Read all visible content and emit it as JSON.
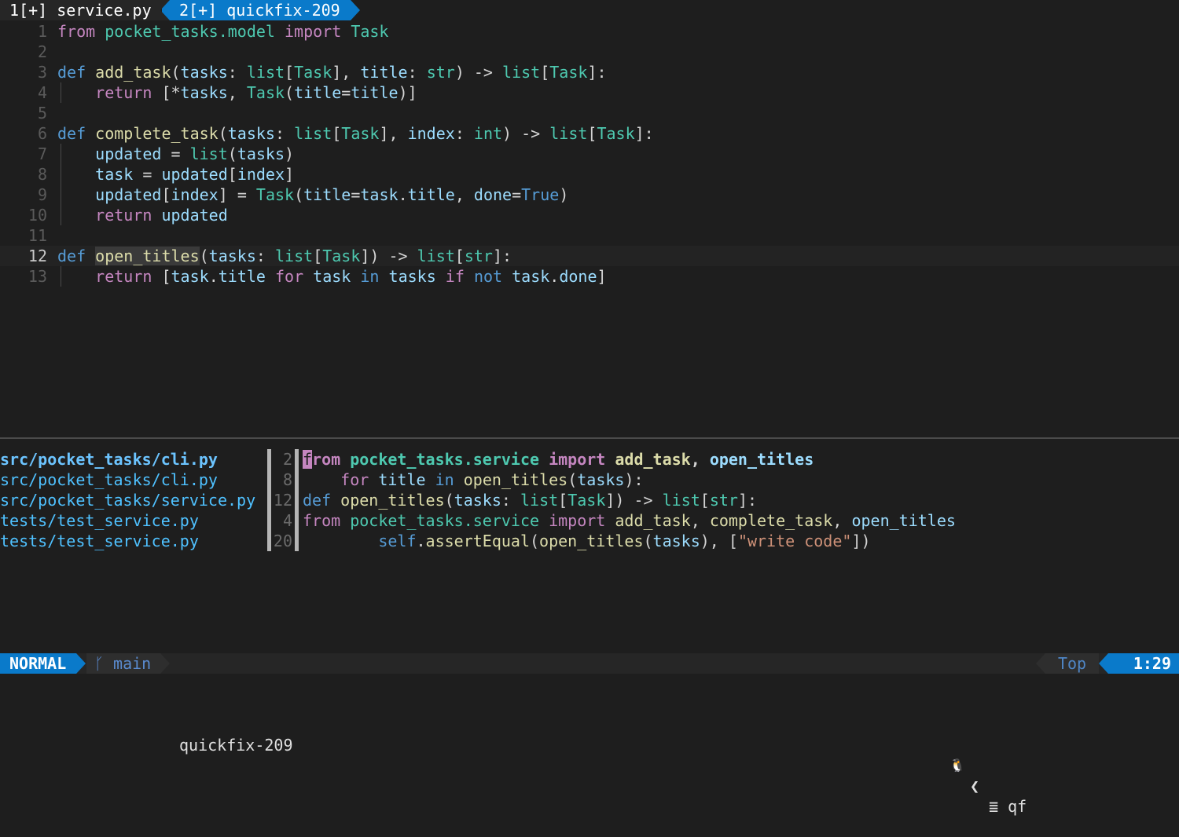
{
  "tabs": [
    {
      "label": "1[+] service.py"
    },
    {
      "label": "2[+] quickfix-209"
    }
  ],
  "editor": {
    "lines": [
      {
        "n": "1",
        "parts": [
          [
            "kw",
            "from"
          ],
          [
            "op",
            " "
          ],
          [
            "ty",
            "pocket_tasks.model"
          ],
          [
            "op",
            " "
          ],
          [
            "kw",
            "import"
          ],
          [
            "op",
            " "
          ],
          [
            "ty",
            "Task"
          ]
        ]
      },
      {
        "n": "2",
        "parts": []
      },
      {
        "n": "3",
        "parts": [
          [
            "kwb",
            "def"
          ],
          [
            "op",
            " "
          ],
          [
            "fn",
            "add_task"
          ],
          [
            "op",
            "("
          ],
          [
            "var",
            "tasks"
          ],
          [
            "op",
            ": "
          ],
          [
            "blt",
            "list"
          ],
          [
            "op",
            "["
          ],
          [
            "ty",
            "Task"
          ],
          [
            "op",
            "], "
          ],
          [
            "var",
            "title"
          ],
          [
            "op",
            ": "
          ],
          [
            "blt",
            "str"
          ],
          [
            "op",
            ") -> "
          ],
          [
            "blt",
            "list"
          ],
          [
            "op",
            "["
          ],
          [
            "ty",
            "Task"
          ],
          [
            "op",
            "]:"
          ]
        ]
      },
      {
        "n": "4",
        "parts": [
          [
            "op",
            "    "
          ],
          [
            "kw",
            "return"
          ],
          [
            "op",
            " [*"
          ],
          [
            "var",
            "tasks"
          ],
          [
            "op",
            ", "
          ],
          [
            "ty",
            "Task"
          ],
          [
            "op",
            "("
          ],
          [
            "var",
            "title"
          ],
          [
            "op",
            "="
          ],
          [
            "var",
            "title"
          ],
          [
            "op",
            ")]"
          ]
        ]
      },
      {
        "n": "5",
        "parts": []
      },
      {
        "n": "6",
        "parts": [
          [
            "kwb",
            "def"
          ],
          [
            "op",
            " "
          ],
          [
            "fn",
            "complete_task"
          ],
          [
            "op",
            "("
          ],
          [
            "var",
            "tasks"
          ],
          [
            "op",
            ": "
          ],
          [
            "blt",
            "list"
          ],
          [
            "op",
            "["
          ],
          [
            "ty",
            "Task"
          ],
          [
            "op",
            "], "
          ],
          [
            "var",
            "index"
          ],
          [
            "op",
            ": "
          ],
          [
            "blt",
            "int"
          ],
          [
            "op",
            ") -> "
          ],
          [
            "blt",
            "list"
          ],
          [
            "op",
            "["
          ],
          [
            "ty",
            "Task"
          ],
          [
            "op",
            "]:"
          ]
        ]
      },
      {
        "n": "7",
        "parts": [
          [
            "op",
            "    "
          ],
          [
            "var",
            "updated"
          ],
          [
            "op",
            " = "
          ],
          [
            "blt",
            "list"
          ],
          [
            "op",
            "("
          ],
          [
            "var",
            "tasks"
          ],
          [
            "op",
            ")"
          ]
        ]
      },
      {
        "n": "8",
        "parts": [
          [
            "op",
            "    "
          ],
          [
            "var",
            "task"
          ],
          [
            "op",
            " = "
          ],
          [
            "var",
            "updated"
          ],
          [
            "op",
            "["
          ],
          [
            "var",
            "index"
          ],
          [
            "op",
            "]"
          ]
        ]
      },
      {
        "n": "9",
        "parts": [
          [
            "op",
            "    "
          ],
          [
            "var",
            "updated"
          ],
          [
            "op",
            "["
          ],
          [
            "var",
            "index"
          ],
          [
            "op",
            "] = "
          ],
          [
            "ty",
            "Task"
          ],
          [
            "op",
            "("
          ],
          [
            "var",
            "title"
          ],
          [
            "op",
            "="
          ],
          [
            "var",
            "task"
          ],
          [
            "op",
            "."
          ],
          [
            "var",
            "title"
          ],
          [
            "op",
            ", "
          ],
          [
            "var",
            "done"
          ],
          [
            "op",
            "="
          ],
          [
            "cnst",
            "True"
          ],
          [
            "op",
            ")"
          ]
        ]
      },
      {
        "n": "10",
        "parts": [
          [
            "op",
            "    "
          ],
          [
            "kw",
            "return"
          ],
          [
            "op",
            " "
          ],
          [
            "var",
            "updated"
          ]
        ]
      },
      {
        "n": "11",
        "parts": []
      },
      {
        "n": "12",
        "parts": [
          [
            "kwb",
            "def"
          ],
          [
            "op",
            " "
          ],
          [
            "fn hl",
            "open_titles"
          ],
          [
            "op",
            "("
          ],
          [
            "var",
            "tasks"
          ],
          [
            "op",
            ": "
          ],
          [
            "blt",
            "list"
          ],
          [
            "op",
            "["
          ],
          [
            "ty",
            "Task"
          ],
          [
            "op",
            "]) -> "
          ],
          [
            "blt",
            "list"
          ],
          [
            "op",
            "["
          ],
          [
            "blt",
            "str"
          ],
          [
            "op",
            "]:"
          ]
        ]
      },
      {
        "n": "13",
        "parts": [
          [
            "op",
            "    "
          ],
          [
            "kw",
            "return"
          ],
          [
            "op",
            " ["
          ],
          [
            "var",
            "task"
          ],
          [
            "op",
            "."
          ],
          [
            "var",
            "title"
          ],
          [
            "op",
            " "
          ],
          [
            "kw",
            "for"
          ],
          [
            "op",
            " "
          ],
          [
            "var",
            "task"
          ],
          [
            "op",
            " "
          ],
          [
            "kwb",
            "in"
          ],
          [
            "op",
            " "
          ],
          [
            "var",
            "tasks"
          ],
          [
            "op",
            " "
          ],
          [
            "kw",
            "if"
          ],
          [
            "op",
            " "
          ],
          [
            "kwb",
            "not"
          ],
          [
            "op",
            " "
          ],
          [
            "var",
            "task"
          ],
          [
            "op",
            "."
          ],
          [
            "var",
            "done"
          ],
          [
            "op",
            "]"
          ]
        ]
      }
    ],
    "current_line": "12"
  },
  "quickfix": {
    "items": [
      {
        "file": "src/pocket_tasks/cli.py",
        "line": "2",
        "parts": [
          [
            "cursor kw",
            "f"
          ],
          [
            "kw bold",
            "rom"
          ],
          [
            "op",
            " "
          ],
          [
            "ty bold",
            "pocket_tasks.service"
          ],
          [
            "op",
            " "
          ],
          [
            "kw bold",
            "import"
          ],
          [
            "op",
            " "
          ],
          [
            "fn bold",
            "add_task"
          ],
          [
            "op bold",
            ", "
          ],
          [
            "var bold",
            "open_titles"
          ]
        ]
      },
      {
        "file": "src/pocket_tasks/cli.py",
        "line": "8",
        "parts": [
          [
            "op",
            "    "
          ],
          [
            "kw",
            "for"
          ],
          [
            "op",
            " "
          ],
          [
            "var",
            "title"
          ],
          [
            "op",
            " "
          ],
          [
            "kwb",
            "in"
          ],
          [
            "op",
            " "
          ],
          [
            "fn",
            "open_titles"
          ],
          [
            "op",
            "("
          ],
          [
            "var",
            "tasks"
          ],
          [
            "op",
            "):"
          ]
        ]
      },
      {
        "file": "src/pocket_tasks/service.py",
        "line": "12",
        "parts": [
          [
            "kwb",
            "def"
          ],
          [
            "op",
            " "
          ],
          [
            "fn",
            "open_titles"
          ],
          [
            "op",
            "("
          ],
          [
            "var",
            "tasks"
          ],
          [
            "op",
            ": "
          ],
          [
            "blt",
            "list"
          ],
          [
            "op",
            "["
          ],
          [
            "ty",
            "Task"
          ],
          [
            "op",
            "]) -> "
          ],
          [
            "blt",
            "list"
          ],
          [
            "op",
            "["
          ],
          [
            "blt",
            "str"
          ],
          [
            "op",
            "]:"
          ]
        ]
      },
      {
        "file": "tests/test_service.py",
        "line": "4",
        "parts": [
          [
            "kw",
            "from"
          ],
          [
            "op",
            " "
          ],
          [
            "ty",
            "pocket_tasks.service"
          ],
          [
            "op",
            " "
          ],
          [
            "kw",
            "import"
          ],
          [
            "op",
            " "
          ],
          [
            "fn",
            "add_task"
          ],
          [
            "op",
            ", "
          ],
          [
            "fn",
            "complete_task"
          ],
          [
            "op",
            ", "
          ],
          [
            "var",
            "open_titles"
          ]
        ]
      },
      {
        "file": "tests/test_service.py",
        "line": "20",
        "parts": [
          [
            "op",
            "        "
          ],
          [
            "kwb",
            "self"
          ],
          [
            "op",
            "."
          ],
          [
            "fn",
            "assertEqual"
          ],
          [
            "op",
            "("
          ],
          [
            "fn",
            "open_titles"
          ],
          [
            "op",
            "("
          ],
          [
            "var",
            "tasks"
          ],
          [
            "op",
            "), ["
          ],
          [
            "str",
            "\"write code\""
          ],
          [
            "op",
            "])"
          ]
        ]
      }
    ]
  },
  "statusline": {
    "mode": "NORMAL",
    "branch_icon": "git-branch-icon",
    "branch_glyph": "ᚴ",
    "branch": "main",
    "file": "quickfix-209",
    "os_icon": "linux-tux-icon",
    "os_glyph": "🐧",
    "chevron": "❮",
    "filetype_icon": "lines-icon",
    "filetype_glyph": "≣",
    "filetype": "qf",
    "position": "Top",
    "cursor": "1:29"
  },
  "colors": {
    "accent": "#0a7aca",
    "background": "#1e1e1e"
  }
}
